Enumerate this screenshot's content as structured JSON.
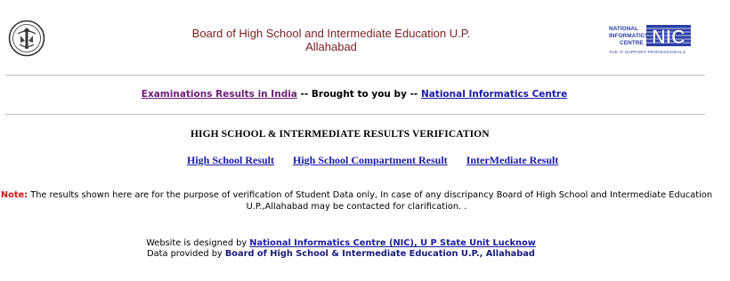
{
  "header": {
    "board_name": "Board of High School and Intermediate Education U.P.",
    "board_city": "Allahabad",
    "nic_logo": {
      "line1": "NATIONAL",
      "line2": "INFORMATICS",
      "line3": "CENTRE",
      "letters": "NIC",
      "tagline": "THE IT SUPPORT PROFESSIONALS"
    }
  },
  "results_line": {
    "link1": "Examinations Results in India",
    "text": " -- Brought to you by -- ",
    "link2": "National Informatics Centre"
  },
  "verification_title": "HIGH SCHOOL & INTERMEDIATE RESULTS VERIFICATION",
  "nav": {
    "high_school": "High School Result",
    "compartment": "High School Compartment Result",
    "intermediate": "InterMediate Result"
  },
  "note": {
    "label": "Note:",
    "text": " The results shown here are for the purpose of verification of Student Data only, In case of any discripancy Board of High School and Intermediate Education U.P.,Allahabad may be contacted for clarification. ."
  },
  "footer": {
    "designed_prefix": "Website is designed by ",
    "designed_link": "National Informatics Centre (NIC), U P State Unit Lucknow",
    "data_prefix": "Data provided by ",
    "data_source": "Board of High School & Intermediate Education  U.P., Allahabad"
  },
  "colors": {
    "title": "#7a1f1f",
    "link": "#1a1aa6",
    "visited": "#6b1e74",
    "note_label": "#d41414",
    "nic_blue": "#2b3fa8"
  }
}
